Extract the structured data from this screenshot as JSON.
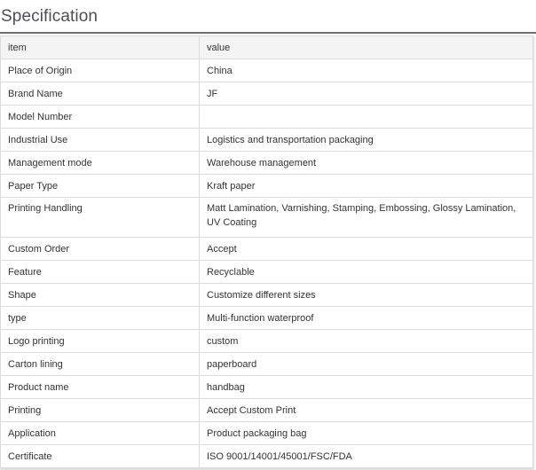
{
  "section": {
    "title": "Specification"
  },
  "table": {
    "header": {
      "item": "item",
      "value": "value"
    },
    "rows": [
      {
        "item": "Place of Origin",
        "value": "China"
      },
      {
        "item": "Brand Name",
        "value": "JF"
      },
      {
        "item": "Model Number",
        "value": ""
      },
      {
        "item": "Industrial Use",
        "value": "Logistics and transportation packaging"
      },
      {
        "item": "Management mode",
        "value": "Warehouse management"
      },
      {
        "item": "Paper Type",
        "value": "Kraft paper"
      },
      {
        "item": "Printing Handling",
        "value": "Matt Lamination, Varnishing, Stamping, Embossing, Glossy Lamination, UV Coating"
      },
      {
        "item": "Custom Order",
        "value": "Accept"
      },
      {
        "item": "Feature",
        "value": "Recyclable"
      },
      {
        "item": "Shape",
        "value": "Customize different sizes"
      },
      {
        "item": "type",
        "value": "Multi-function waterproof"
      },
      {
        "item": "Logo printing",
        "value": "custom"
      },
      {
        "item": "Carton lining",
        "value": "paperboard"
      },
      {
        "item": "Product name",
        "value": "handbag"
      },
      {
        "item": "Printing",
        "value": "Accept Custom Print"
      },
      {
        "item": "Application",
        "value": "Product packaging bag"
      },
      {
        "item": "Certificate",
        "value": "ISO 9001/14001/45001/FSC/FDA"
      }
    ]
  }
}
